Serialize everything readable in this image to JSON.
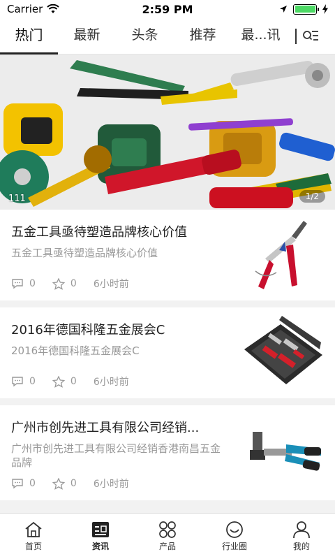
{
  "status": {
    "carrier": "Carrier",
    "time": "2:59 PM",
    "battery_level": 1.0
  },
  "tabs": [
    {
      "label": "热门",
      "active": true
    },
    {
      "label": "最新",
      "active": false
    },
    {
      "label": "头条",
      "active": false
    },
    {
      "label": "推荐",
      "active": false
    },
    {
      "label": "最...讯",
      "active": false
    }
  ],
  "banner": {
    "caption": "111",
    "pager": "1/2"
  },
  "news": [
    {
      "title": "五金工具亟待塑造品牌核心价值",
      "summary": "五金工具亟待塑造品牌核心价值",
      "comments": "0",
      "likes": "0",
      "time": "6小时前",
      "thumb_icon": "rivet-gun-icon"
    },
    {
      "title": "2016年德国科隆五金展会C",
      "summary": "2016年德国科隆五金展会C",
      "comments": "0",
      "likes": "0",
      "time": "6小时前",
      "thumb_icon": "tool-kit-icon"
    },
    {
      "title": "广州市创先进工具有限公司经销...",
      "summary": "广州市创先进工具有限公司经销香港南昌五金品牌",
      "comments": "0",
      "likes": "0",
      "time": "6小时前",
      "thumb_icon": "crimping-tool-icon"
    }
  ],
  "tabbar": [
    {
      "label": "首页",
      "icon": "home-icon",
      "active": false
    },
    {
      "label": "资讯",
      "icon": "news-icon",
      "active": true
    },
    {
      "label": "产品",
      "icon": "products-icon",
      "active": false
    },
    {
      "label": "行业圈",
      "icon": "community-icon",
      "active": false
    },
    {
      "label": "我的",
      "icon": "profile-icon",
      "active": false
    }
  ],
  "colors": {
    "accent": "#222222",
    "muted": "#999999",
    "battery": "#4cd964"
  }
}
